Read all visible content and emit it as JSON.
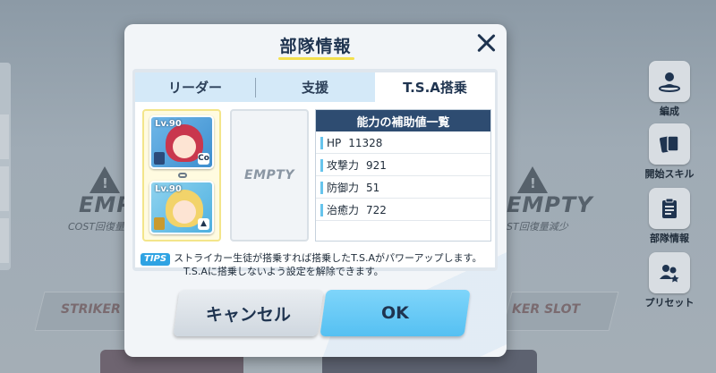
{
  "modal": {
    "title": "部隊情報",
    "tabs": [
      "リーダー",
      "支援",
      "T.S.A搭乗"
    ],
    "active_tab": "T.S.A搭乗",
    "units": [
      {
        "level": "Lv.90",
        "hair_color": "#c9374d"
      },
      {
        "level": "Lv.90",
        "hair_color": "#f2d36a"
      }
    ],
    "empty_slot_text": "EMPTY",
    "stats": {
      "header": "能力の補助値一覧",
      "rows": [
        {
          "name": "HP",
          "value": "11328"
        },
        {
          "name": "攻撃力",
          "value": "921"
        },
        {
          "name": "防御力",
          "value": "51"
        },
        {
          "name": "治癒力",
          "value": "722"
        }
      ]
    },
    "tips": {
      "badge": "TIPS",
      "line1": "ストライカー生徒が搭乗すれば搭乗したT.S.Aがパワーアップします。",
      "line2": "T.S.Aに搭乗しないよう設定を解除できます。"
    },
    "buttons": {
      "cancel": "キャンセル",
      "ok": "OK"
    }
  },
  "background": {
    "empty_left": "EMPT",
    "empty_right": "EMPTY",
    "cost_left": "COST回復量",
    "cost_right": "ST回復量減少",
    "striker_left": "STRIKER S",
    "striker_right": "KER SLOT"
  },
  "side_menu": [
    {
      "label": "編成",
      "icon": "formation-icon"
    },
    {
      "label": "開始スキル",
      "icon": "cards-icon"
    },
    {
      "label": "部隊情報",
      "icon": "clipboard-icon"
    },
    {
      "label": "プリセット",
      "icon": "preset-icon"
    }
  ],
  "colors": {
    "accent_blue": "#55c0f2",
    "header_navy": "#2e4c71",
    "title_underline": "#f3e04e"
  }
}
